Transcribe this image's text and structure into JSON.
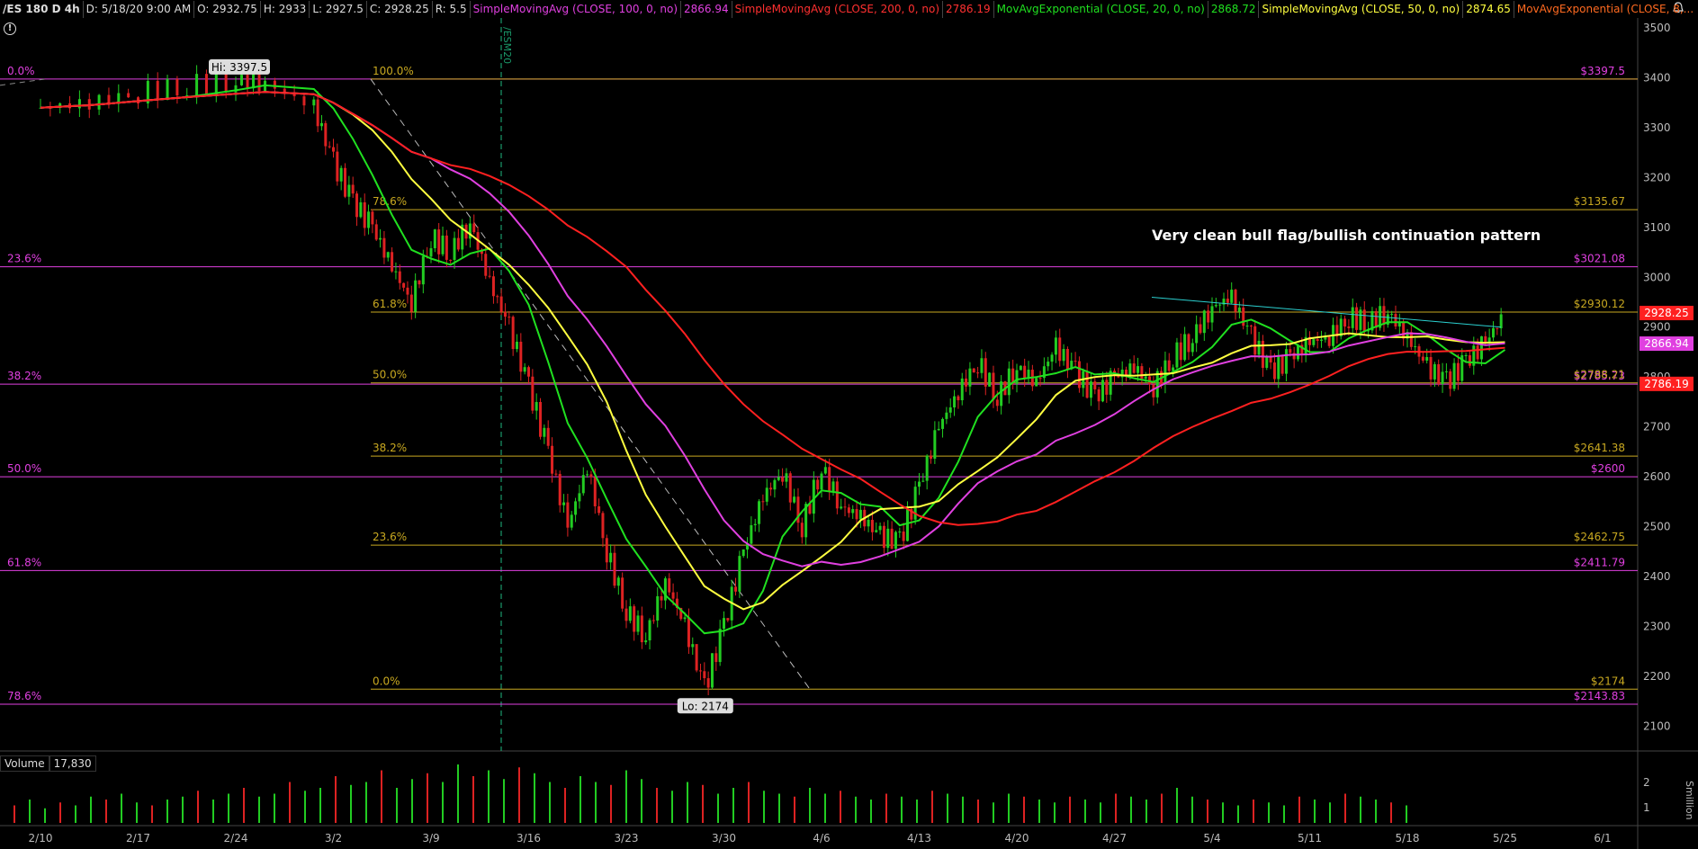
{
  "header": {
    "symbol": "/ES 180 D 4h",
    "date": "D: 5/18/20 9:00 AM",
    "open": "O: 2932.75",
    "high": "H: 2933",
    "low": "L: 2927.5",
    "close": "C: 2928.25",
    "range": "R: 5.5",
    "studies": [
      {
        "label": "SimpleMovingAvg (CLOSE, 100, 0, no)",
        "value": "2866.94",
        "color": "#e040e0"
      },
      {
        "label": "SimpleMovingAvg (CLOSE, 200, 0, no)",
        "value": "2786.19",
        "color": "#ff2020"
      },
      {
        "label": "MovAvgExponential (CLOSE, 20, 0, no)",
        "value": "2868.72",
        "color": "#20e020"
      },
      {
        "label": "SimpleMovingAvg (CLOSE, 50, 0, no)",
        "value": "2874.65",
        "color": "#ffff40"
      },
      {
        "label": "MovAvgExponential (CLOSE, 8,...",
        "value": "",
        "color": "#ff6a20"
      }
    ]
  },
  "annotation": "Very clean bull flag/bullish continuation pattern",
  "volume": {
    "label": "Volume",
    "value": "17,830",
    "axis_ticks": [
      "2",
      "1"
    ],
    "unit_label": "Smillion"
  },
  "colors": {
    "fib_left": "#e040e0",
    "fib_right": "#c8a820",
    "up": "#22cc22",
    "down": "#dd2222",
    "contract_roll": "#1a9a6a"
  },
  "chart_data": {
    "type": "line",
    "title": "",
    "x_labels": [
      "2/10",
      "2/17",
      "2/24",
      "3/2",
      "3/9",
      "3/16",
      "3/23",
      "3/30",
      "4/6",
      "4/13",
      "4/20",
      "4/27",
      "5/4",
      "5/11",
      "5/18",
      "5/25",
      "6/1"
    ],
    "y_ticks": [
      2100,
      2200,
      2300,
      2400,
      2500,
      2600,
      2700,
      2800,
      2900,
      3000,
      3100,
      3200,
      3300,
      3400,
      3500
    ],
    "ylim": [
      2050,
      3520
    ],
    "contract_marker": "/ESM20",
    "high_label": "Hi: 3397.5",
    "low_label": "Lo: 2174",
    "price_badges": [
      {
        "value": 2928.25,
        "label": "2928.25",
        "color": "#ff2020"
      },
      {
        "value": 2866.94,
        "label": "2866.94",
        "color": "#e040e0"
      },
      {
        "value": 2786.19,
        "label": "2786.19",
        "color": "#ff2020"
      }
    ],
    "fib_left": [
      {
        "pct": "0.0%",
        "price": 3397.5,
        "label": "$3397.5"
      },
      {
        "pct": "23.6%",
        "price": 3021.08,
        "label": "$3021.08"
      },
      {
        "pct": "38.2%",
        "price": 2785.73,
        "label": "$2785.73"
      },
      {
        "pct": "50.0%",
        "price": 2600,
        "label": "$2600"
      },
      {
        "pct": "61.8%",
        "price": 2411.79,
        "label": "$2411.79"
      },
      {
        "pct": "78.6%",
        "price": 2143.83,
        "label": "$2143.83"
      }
    ],
    "fib_right": [
      {
        "pct": "100.0%",
        "price": 3397.5,
        "label": ""
      },
      {
        "pct": "78.6%",
        "price": 3135.67,
        "label": "$3135.67"
      },
      {
        "pct": "61.8%",
        "price": 2930.12,
        "label": "$2930.12"
      },
      {
        "pct": "50.0%",
        "price": 2788.21,
        "label": "$2788.21"
      },
      {
        "pct": "38.2%",
        "price": 2641.38,
        "label": "$2641.38"
      },
      {
        "pct": "23.6%",
        "price": 2462.75,
        "label": "$2462.75"
      },
      {
        "pct": "0.0%",
        "price": 2174,
        "label": "$2174"
      }
    ],
    "price_path": [
      [
        0,
        3340
      ],
      [
        0.5,
        3350
      ],
      [
        1,
        3370
      ],
      [
        1.5,
        3385
      ],
      [
        2,
        3395
      ],
      [
        2.3,
        3390
      ],
      [
        2.8,
        3340
      ],
      [
        3.0,
        3230
      ],
      [
        3.2,
        3150
      ],
      [
        3.4,
        3100
      ],
      [
        3.6,
        3020
      ],
      [
        3.8,
        2950
      ],
      [
        4.0,
        3080
      ],
      [
        4.2,
        3050
      ],
      [
        4.4,
        3110
      ],
      [
        4.6,
        2990
      ],
      [
        4.8,
        2900
      ],
      [
        5.0,
        2780
      ],
      [
        5.2,
        2650
      ],
      [
        5.4,
        2500
      ],
      [
        5.6,
        2620
      ],
      [
        5.8,
        2450
      ],
      [
        6.0,
        2330
      ],
      [
        6.2,
        2280
      ],
      [
        6.4,
        2390
      ],
      [
        6.6,
        2300
      ],
      [
        6.8,
        2174
      ],
      [
        7.0,
        2300
      ],
      [
        7.2,
        2450
      ],
      [
        7.4,
        2560
      ],
      [
        7.6,
        2610
      ],
      [
        7.8,
        2500
      ],
      [
        8.0,
        2620
      ],
      [
        8.2,
        2540
      ],
      [
        8.4,
        2520
      ],
      [
        8.6,
        2480
      ],
      [
        8.8,
        2470
      ],
      [
        9.0,
        2580
      ],
      [
        9.2,
        2700
      ],
      [
        9.4,
        2770
      ],
      [
        9.6,
        2830
      ],
      [
        9.8,
        2760
      ],
      [
        10.0,
        2820
      ],
      [
        10.2,
        2790
      ],
      [
        10.4,
        2860
      ],
      [
        10.6,
        2810
      ],
      [
        10.8,
        2760
      ],
      [
        11.0,
        2800
      ],
      [
        11.2,
        2820
      ],
      [
        11.4,
        2780
      ],
      [
        11.6,
        2840
      ],
      [
        11.8,
        2880
      ],
      [
        12.0,
        2940
      ],
      [
        12.2,
        2960
      ],
      [
        12.4,
        2880
      ],
      [
        12.6,
        2810
      ],
      [
        12.8,
        2840
      ],
      [
        13.0,
        2870
      ],
      [
        13.2,
        2880
      ],
      [
        13.4,
        2920
      ],
      [
        13.6,
        2910
      ],
      [
        13.8,
        2930
      ],
      [
        14.0,
        2880
      ],
      [
        14.2,
        2820
      ],
      [
        14.4,
        2790
      ],
      [
        14.6,
        2830
      ],
      [
        14.8,
        2870
      ],
      [
        15.0,
        2928
      ]
    ],
    "volume_bars": [
      0.3,
      0.4,
      0.25,
      0.35,
      0.3,
      0.45,
      0.4,
      0.5,
      0.35,
      0.3,
      0.4,
      0.45,
      0.55,
      0.4,
      0.5,
      0.6,
      0.45,
      0.5,
      0.7,
      0.55,
      0.6,
      0.8,
      0.65,
      0.7,
      0.9,
      0.6,
      0.75,
      0.85,
      0.7,
      1.0,
      0.8,
      0.9,
      0.75,
      0.95,
      0.85,
      0.7,
      0.6,
      0.8,
      0.7,
      0.65,
      0.9,
      0.75,
      0.6,
      0.55,
      0.7,
      0.65,
      0.5,
      0.6,
      0.7,
      0.55,
      0.5,
      0.45,
      0.6,
      0.5,
      0.55,
      0.45,
      0.4,
      0.5,
      0.45,
      0.4,
      0.55,
      0.5,
      0.45,
      0.4,
      0.35,
      0.5,
      0.45,
      0.4,
      0.35,
      0.45,
      0.4,
      0.35,
      0.5,
      0.45,
      0.4,
      0.5,
      0.6,
      0.45,
      0.4,
      0.35,
      0.3,
      0.4,
      0.35,
      0.3,
      0.45,
      0.4,
      0.35,
      0.5,
      0.45,
      0.4,
      0.35,
      0.3
    ]
  }
}
